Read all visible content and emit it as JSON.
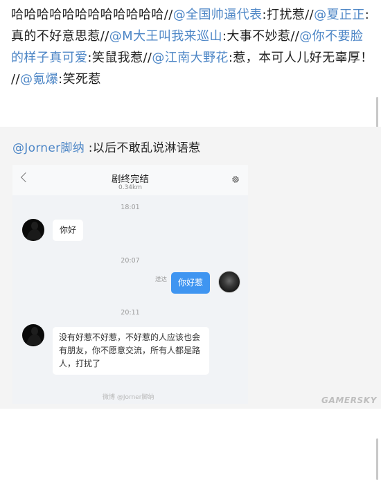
{
  "post": {
    "segments": [
      {
        "t": "哈哈哈哈哈哈哈哈哈哈哈哈//",
        "m": false
      },
      {
        "t": "@全国帅逼代表",
        "m": true
      },
      {
        "t": ":打扰惹//",
        "m": false
      },
      {
        "t": "@夏正正",
        "m": true
      },
      {
        "t": ": 真的不好意思惹//",
        "m": false
      },
      {
        "t": "@M大王叫我来巡山",
        "m": true
      },
      {
        "t": ":大事不妙惹//",
        "m": false
      },
      {
        "t": "@你不要脸的样子真可爱",
        "m": true
      },
      {
        "t": ":笑鼠我惹//",
        "m": false
      },
      {
        "t": "@江南大野花",
        "m": true
      },
      {
        "t": ":惹，本可人儿好无辜厚！ //",
        "m": false
      },
      {
        "t": "@氪爆",
        "m": true
      },
      {
        "t": ":笑死惹",
        "m": false
      }
    ]
  },
  "comment": {
    "author": "@Jorner脚纳",
    "text": " :以后不敢乱说淋语惹"
  },
  "chat": {
    "title": "剧终完结",
    "distance": "0.34km",
    "messages": [
      {
        "time": "18:01"
      },
      {
        "side": "left",
        "text": "你好"
      },
      {
        "time": "20:07"
      },
      {
        "side": "right",
        "text": "你好惹",
        "status": "送达"
      },
      {
        "time": "20:11"
      },
      {
        "side": "left",
        "text": "没有好惹不好惹，不好惹的人应该也会有朋友，你不愿意交流，所有人都是路人，打扰了"
      }
    ],
    "watermark": "微博 @Jorner脚纳"
  },
  "site_watermark": "GAMERSKY",
  "colors": {
    "mention": "#4d86c6",
    "bubble_right": "#3f95f1",
    "comment_bg": "#f4f4f4"
  }
}
